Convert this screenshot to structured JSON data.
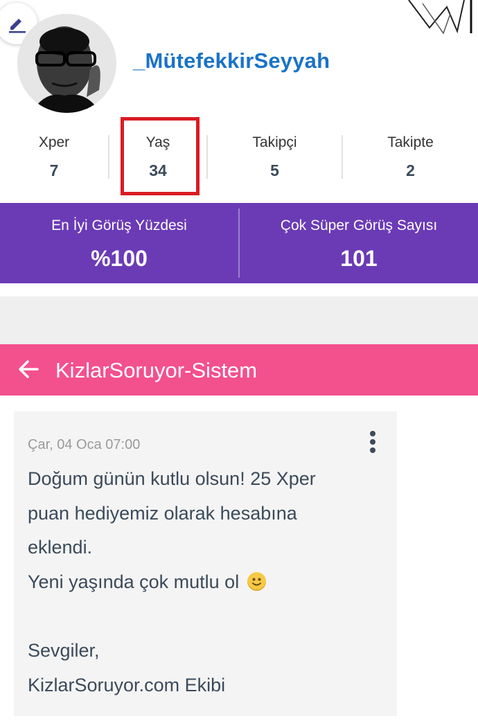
{
  "profile": {
    "username": "_MütefekkirSeyyah"
  },
  "stats": [
    {
      "label": "Xper",
      "value": "7"
    },
    {
      "label": "Yaş",
      "value": "34"
    },
    {
      "label": "Takipçi",
      "value": "5"
    },
    {
      "label": "Takipte",
      "value": "2"
    }
  ],
  "highlight": {
    "target": "Yaş",
    "color": "#d91c24"
  },
  "purple_stats": [
    {
      "label": "En İyi Görüş Yüzdesi",
      "value": "%100"
    },
    {
      "label": "Çok Süper Görüş Sayısı",
      "value": "101"
    }
  ],
  "notification_header": {
    "title": "KizlarSoruyor-Sistem"
  },
  "message": {
    "date": "Çar, 04 Oca 07:00",
    "lines": [
      "Doğum günün kutlu olsun! 25 Xper",
      "puan hediyemiz olarak hesabına",
      "eklendi.",
      "Yeni yaşında çok mutlu ol",
      "",
      "Sevgiler,",
      "KizlarSoruyor.com Ekibi"
    ]
  },
  "icons": {
    "edit": "pencil-icon",
    "back": "arrow-left-icon",
    "menu": "kebab-menu-icon",
    "emoji": "smiley-emoji"
  },
  "colors": {
    "username": "#1a73c8",
    "purple_band": "#6b3bb6",
    "pink_bar": "#f3508e",
    "highlight_box": "#d91c24"
  }
}
